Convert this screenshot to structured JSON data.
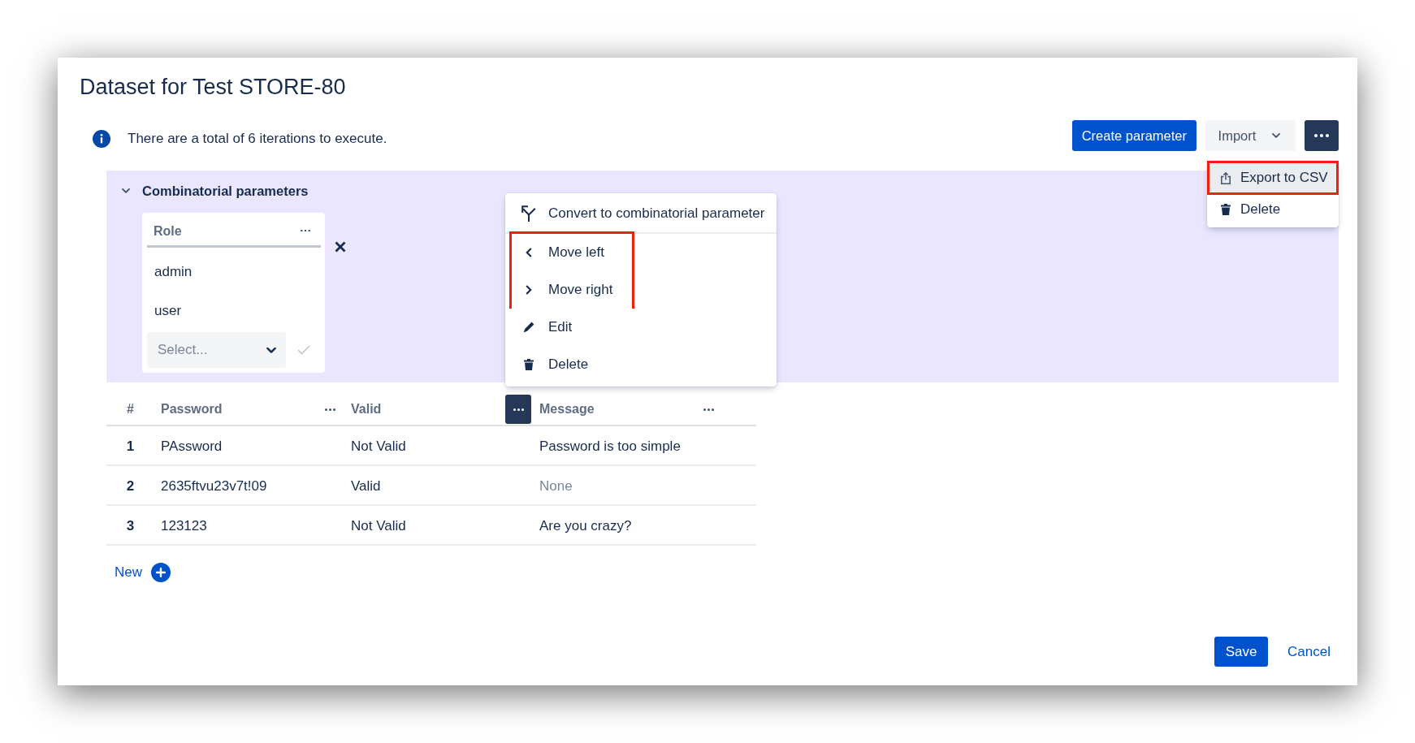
{
  "dialog": {
    "title": "Dataset for Test STORE-80"
  },
  "info": {
    "text": "There are a total of 6 iterations to execute."
  },
  "toolbar": {
    "buttons": [
      {
        "kind": "primary",
        "label": "Create parameter"
      },
      {
        "kind": "dropdown",
        "label": "Import"
      },
      {
        "kind": "more",
        "expanded": true,
        "menu": {
          "items": [
            {
              "kind": "export",
              "label": "Export to CSV",
              "highlighted": true,
              "hovered": true
            },
            {
              "kind": "delete",
              "label": "Delete",
              "highlighted": false,
              "hovered": false
            }
          ]
        }
      }
    ]
  },
  "combinatorial": {
    "title": "Combinatorial parameters",
    "expanded": true,
    "parameters": [
      {
        "name": "Role",
        "values": [
          "admin",
          "user"
        ],
        "select": {
          "placeholder": "Select..."
        }
      }
    ]
  },
  "table": {
    "columns": [
      {
        "kind": "index",
        "label": "#"
      },
      {
        "kind": "parameter",
        "label": "Password",
        "expanded": false
      },
      {
        "kind": "parameter",
        "label": "Valid",
        "expanded": true,
        "menu": {
          "sections": [
            {
              "items": [
                {
                  "kind": "convert",
                  "label": "Convert to combinatorial parameter",
                  "highlighted": false,
                  "hovered": false
                }
              ]
            },
            {
              "items": [
                {
                  "kind": "left",
                  "label": "Move left",
                  "highlighted": true,
                  "hovered": false
                },
                {
                  "kind": "right",
                  "label": "Move right",
                  "highlighted": true,
                  "hovered": false
                },
                {
                  "kind": "edit",
                  "label": "Edit",
                  "highlighted": false,
                  "hovered": false
                },
                {
                  "kind": "delete",
                  "label": "Delete",
                  "highlighted": false,
                  "hovered": false
                }
              ]
            }
          ]
        }
      },
      {
        "kind": "parameter",
        "label": "Message",
        "expanded": false
      }
    ],
    "rows": [
      {
        "cells": [
          {
            "text": "1",
            "empty": false
          },
          {
            "text": "PAssword",
            "empty": false
          },
          {
            "text": "Not Valid",
            "empty": false
          },
          {
            "text": "Password is too simple",
            "empty": false
          }
        ]
      },
      {
        "cells": [
          {
            "text": "2",
            "empty": false
          },
          {
            "text": "2635ftvu23v7t!09",
            "empty": false
          },
          {
            "text": "Valid",
            "empty": false
          },
          {
            "text": "None",
            "empty": true
          }
        ]
      },
      {
        "cells": [
          {
            "text": "3",
            "empty": false
          },
          {
            "text": "123123",
            "empty": false
          },
          {
            "text": "Not Valid",
            "empty": false
          },
          {
            "text": "Are you crazy?",
            "empty": false
          }
        ]
      }
    ],
    "add_button": {
      "label": "New"
    }
  },
  "footer": {
    "buttons": [
      {
        "kind": "primary",
        "label": "Save"
      },
      {
        "kind": "link",
        "label": "Cancel"
      }
    ]
  }
}
